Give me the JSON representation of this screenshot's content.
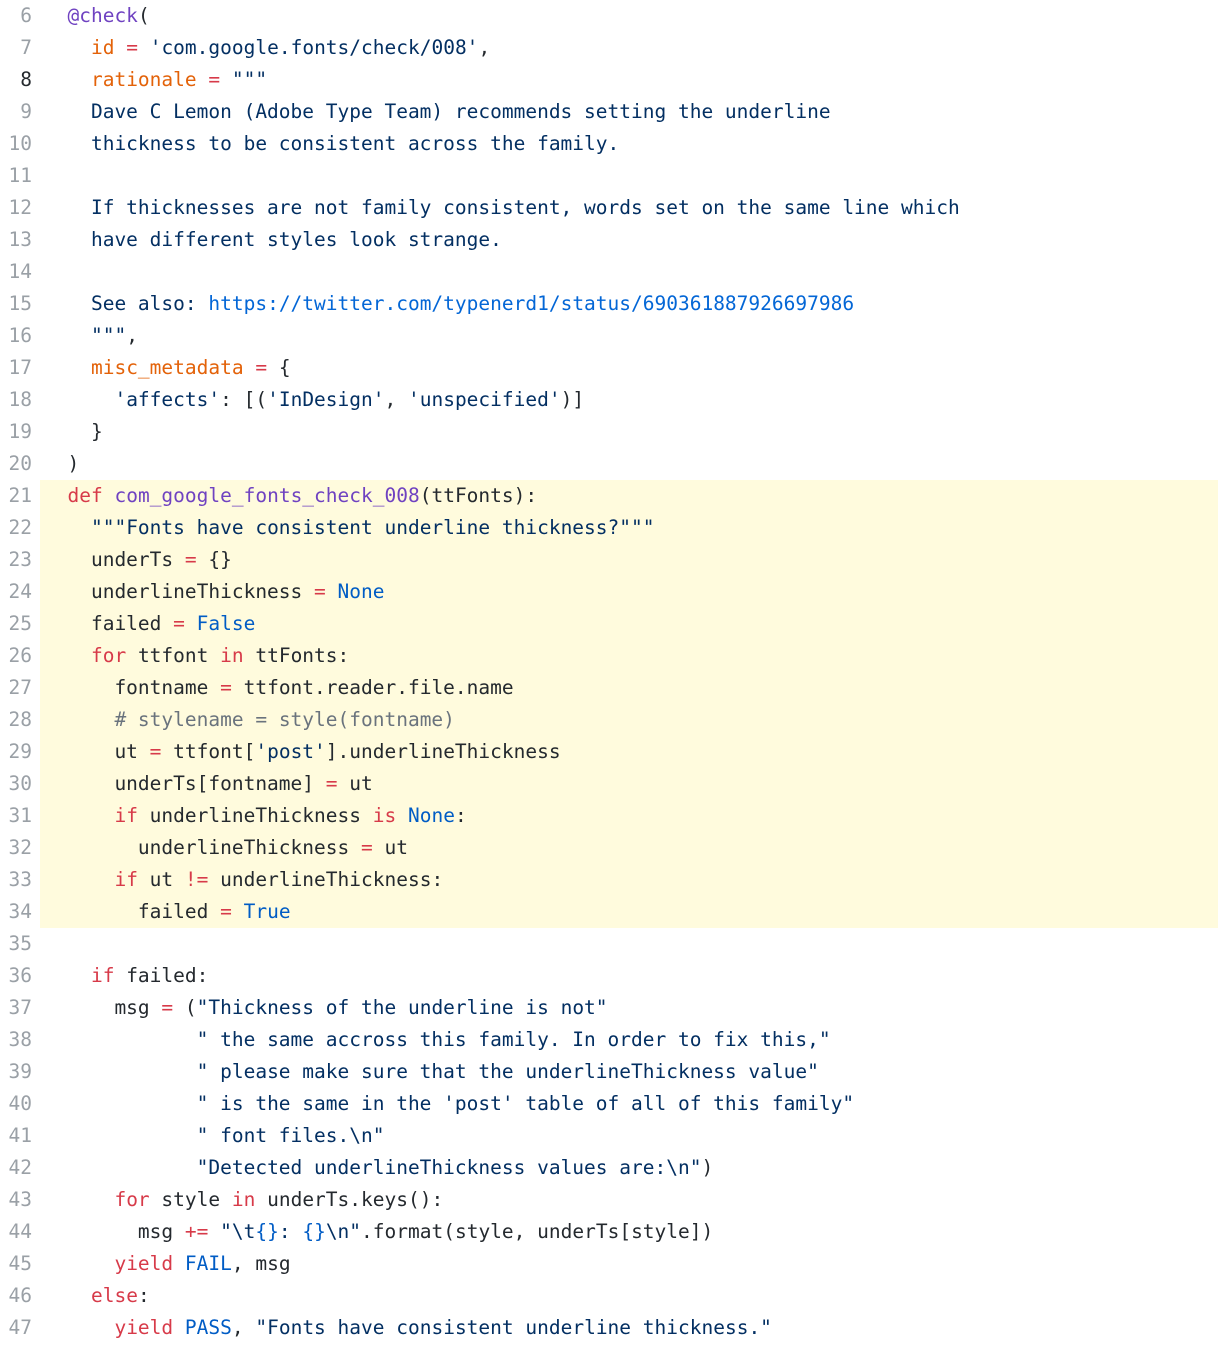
{
  "editor": {
    "current_line": 8,
    "highlight_range": [
      21,
      34
    ],
    "colors": {
      "highlight_bg": "#fffbdd",
      "keyword": "#d73a49",
      "decorator": "#6f42c1",
      "attribute": "#e36209",
      "function": "#6f42c1",
      "constant": "#005cc5",
      "string": "#032f62",
      "url": "#0366d6",
      "comment": "#6a737d",
      "line_number": "#9aa0a6"
    },
    "lines": [
      {
        "n": "6",
        "tokens": [
          {
            "t": "  "
          },
          {
            "t": "@check",
            "k": "dec"
          },
          {
            "t": "("
          }
        ]
      },
      {
        "n": "7",
        "tokens": [
          {
            "t": "    "
          },
          {
            "t": "id",
            "k": "attr"
          },
          {
            "t": " "
          },
          {
            "t": "=",
            "k": "op"
          },
          {
            "t": " "
          },
          {
            "t": "'com.google.fonts/check/008'",
            "k": "str"
          },
          {
            "t": ","
          }
        ]
      },
      {
        "n": "8",
        "tokens": [
          {
            "t": "    "
          },
          {
            "t": "rationale",
            "k": "attr"
          },
          {
            "t": " "
          },
          {
            "t": "=",
            "k": "op"
          },
          {
            "t": " "
          },
          {
            "t": "\"\"\"",
            "k": "str"
          }
        ]
      },
      {
        "n": "9",
        "tokens": [
          {
            "t": "    Dave C Lemon (Adobe Type Team) recommends setting the underline",
            "k": "str"
          }
        ]
      },
      {
        "n": "10",
        "tokens": [
          {
            "t": "    thickness to be consistent across the family.",
            "k": "str"
          }
        ]
      },
      {
        "n": "11",
        "tokens": []
      },
      {
        "n": "12",
        "tokens": [
          {
            "t": "    If thicknesses are not family consistent, words set on the same line which",
            "k": "str"
          }
        ]
      },
      {
        "n": "13",
        "tokens": [
          {
            "t": "    have different styles look strange.",
            "k": "str"
          }
        ]
      },
      {
        "n": "14",
        "tokens": []
      },
      {
        "n": "15",
        "tokens": [
          {
            "t": "    See also: ",
            "k": "str"
          },
          {
            "t": "https://twitter.com/typenerd1/status/690361887926697986",
            "k": "url"
          }
        ]
      },
      {
        "n": "16",
        "tokens": [
          {
            "t": "    "
          },
          {
            "t": "\"\"\"",
            "k": "str"
          },
          {
            "t": ","
          }
        ]
      },
      {
        "n": "17",
        "tokens": [
          {
            "t": "    "
          },
          {
            "t": "misc_metadata",
            "k": "attr"
          },
          {
            "t": " "
          },
          {
            "t": "=",
            "k": "op"
          },
          {
            "t": " {"
          }
        ]
      },
      {
        "n": "18",
        "tokens": [
          {
            "t": "      "
          },
          {
            "t": "'affects'",
            "k": "str"
          },
          {
            "t": ": [("
          },
          {
            "t": "'InDesign'",
            "k": "str"
          },
          {
            "t": ", "
          },
          {
            "t": "'unspecified'",
            "k": "str"
          },
          {
            "t": ")]"
          }
        ]
      },
      {
        "n": "19",
        "tokens": [
          {
            "t": "    }"
          }
        ]
      },
      {
        "n": "20",
        "tokens": [
          {
            "t": "  )"
          }
        ]
      },
      {
        "n": "21",
        "tokens": [
          {
            "t": "  "
          },
          {
            "t": "def",
            "k": "kw"
          },
          {
            "t": " "
          },
          {
            "t": "com_google_fonts_check_008",
            "k": "fn"
          },
          {
            "t": "(ttFonts):"
          }
        ]
      },
      {
        "n": "22",
        "tokens": [
          {
            "t": "    "
          },
          {
            "t": "\"\"\"Fonts have consistent underline thickness?\"\"\"",
            "k": "str"
          }
        ]
      },
      {
        "n": "23",
        "tokens": [
          {
            "t": "    underTs "
          },
          {
            "t": "=",
            "k": "op"
          },
          {
            "t": " {}"
          }
        ]
      },
      {
        "n": "24",
        "tokens": [
          {
            "t": "    underlineThickness "
          },
          {
            "t": "=",
            "k": "op"
          },
          {
            "t": " "
          },
          {
            "t": "None",
            "k": "con"
          }
        ]
      },
      {
        "n": "25",
        "tokens": [
          {
            "t": "    failed "
          },
          {
            "t": "=",
            "k": "op"
          },
          {
            "t": " "
          },
          {
            "t": "False",
            "k": "con"
          }
        ]
      },
      {
        "n": "26",
        "tokens": [
          {
            "t": "    "
          },
          {
            "t": "for",
            "k": "kw"
          },
          {
            "t": " ttfont "
          },
          {
            "t": "in",
            "k": "kw"
          },
          {
            "t": " ttFonts:"
          }
        ]
      },
      {
        "n": "27",
        "tokens": [
          {
            "t": "      fontname "
          },
          {
            "t": "=",
            "k": "op"
          },
          {
            "t": " ttfont.reader.file.name"
          }
        ]
      },
      {
        "n": "28",
        "tokens": [
          {
            "t": "      "
          },
          {
            "t": "# stylename = style(fontname)",
            "k": "cm"
          }
        ]
      },
      {
        "n": "29",
        "tokens": [
          {
            "t": "      ut "
          },
          {
            "t": "=",
            "k": "op"
          },
          {
            "t": " ttfont["
          },
          {
            "t": "'post'",
            "k": "str"
          },
          {
            "t": "].underlineThickness"
          }
        ]
      },
      {
        "n": "30",
        "tokens": [
          {
            "t": "      underTs[fontname] "
          },
          {
            "t": "=",
            "k": "op"
          },
          {
            "t": " ut"
          }
        ]
      },
      {
        "n": "31",
        "tokens": [
          {
            "t": "      "
          },
          {
            "t": "if",
            "k": "kw"
          },
          {
            "t": " underlineThickness "
          },
          {
            "t": "is",
            "k": "kw"
          },
          {
            "t": " "
          },
          {
            "t": "None",
            "k": "con"
          },
          {
            "t": ":"
          }
        ]
      },
      {
        "n": "32",
        "tokens": [
          {
            "t": "        underlineThickness "
          },
          {
            "t": "=",
            "k": "op"
          },
          {
            "t": " ut"
          }
        ]
      },
      {
        "n": "33",
        "tokens": [
          {
            "t": "      "
          },
          {
            "t": "if",
            "k": "kw"
          },
          {
            "t": " ut "
          },
          {
            "t": "!=",
            "k": "op"
          },
          {
            "t": " underlineThickness:"
          }
        ]
      },
      {
        "n": "34",
        "tokens": [
          {
            "t": "        failed "
          },
          {
            "t": "=",
            "k": "op"
          },
          {
            "t": " "
          },
          {
            "t": "True",
            "k": "con"
          }
        ]
      },
      {
        "n": "35",
        "tokens": []
      },
      {
        "n": "36",
        "tokens": [
          {
            "t": "    "
          },
          {
            "t": "if",
            "k": "kw"
          },
          {
            "t": " failed:"
          }
        ]
      },
      {
        "n": "37",
        "tokens": [
          {
            "t": "      msg "
          },
          {
            "t": "=",
            "k": "op"
          },
          {
            "t": " ("
          },
          {
            "t": "\"Thickness of the underline is not\"",
            "k": "str"
          }
        ]
      },
      {
        "n": "38",
        "tokens": [
          {
            "t": "             "
          },
          {
            "t": "\" the same accross this family. In order to fix this,\"",
            "k": "str"
          }
        ]
      },
      {
        "n": "39",
        "tokens": [
          {
            "t": "             "
          },
          {
            "t": "\" please make sure that the underlineThickness value\"",
            "k": "str"
          }
        ]
      },
      {
        "n": "40",
        "tokens": [
          {
            "t": "             "
          },
          {
            "t": "\" is the same in the 'post' table of all of this family\"",
            "k": "str"
          }
        ]
      },
      {
        "n": "41",
        "tokens": [
          {
            "t": "             "
          },
          {
            "t": "\" font files.\\n\"",
            "k": "str"
          }
        ]
      },
      {
        "n": "42",
        "tokens": [
          {
            "t": "             "
          },
          {
            "t": "\"Detected underlineThickness values are:\\n\"",
            "k": "str"
          },
          {
            "t": ")"
          }
        ]
      },
      {
        "n": "43",
        "tokens": [
          {
            "t": "      "
          },
          {
            "t": "for",
            "k": "kw"
          },
          {
            "t": " style "
          },
          {
            "t": "in",
            "k": "kw"
          },
          {
            "t": " underTs.keys():"
          }
        ]
      },
      {
        "n": "44",
        "tokens": [
          {
            "t": "        msg "
          },
          {
            "t": "+=",
            "k": "op"
          },
          {
            "t": " "
          },
          {
            "t": "\"\\t",
            "k": "str"
          },
          {
            "t": "{}",
            "k": "con"
          },
          {
            "t": ": ",
            "k": "str"
          },
          {
            "t": "{}",
            "k": "con"
          },
          {
            "t": "\\n\"",
            "k": "str"
          },
          {
            "t": ".format(style, underTs[style])"
          }
        ]
      },
      {
        "n": "45",
        "tokens": [
          {
            "t": "      "
          },
          {
            "t": "yield",
            "k": "kw"
          },
          {
            "t": " "
          },
          {
            "t": "FAIL",
            "k": "con"
          },
          {
            "t": ", msg"
          }
        ]
      },
      {
        "n": "46",
        "tokens": [
          {
            "t": "    "
          },
          {
            "t": "else",
            "k": "kw"
          },
          {
            "t": ":"
          }
        ]
      },
      {
        "n": "47",
        "tokens": [
          {
            "t": "      "
          },
          {
            "t": "yield",
            "k": "kw"
          },
          {
            "t": " "
          },
          {
            "t": "PASS",
            "k": "con"
          },
          {
            "t": ", "
          },
          {
            "t": "\"Fonts have consistent underline thickness.\"",
            "k": "str"
          }
        ]
      }
    ]
  }
}
